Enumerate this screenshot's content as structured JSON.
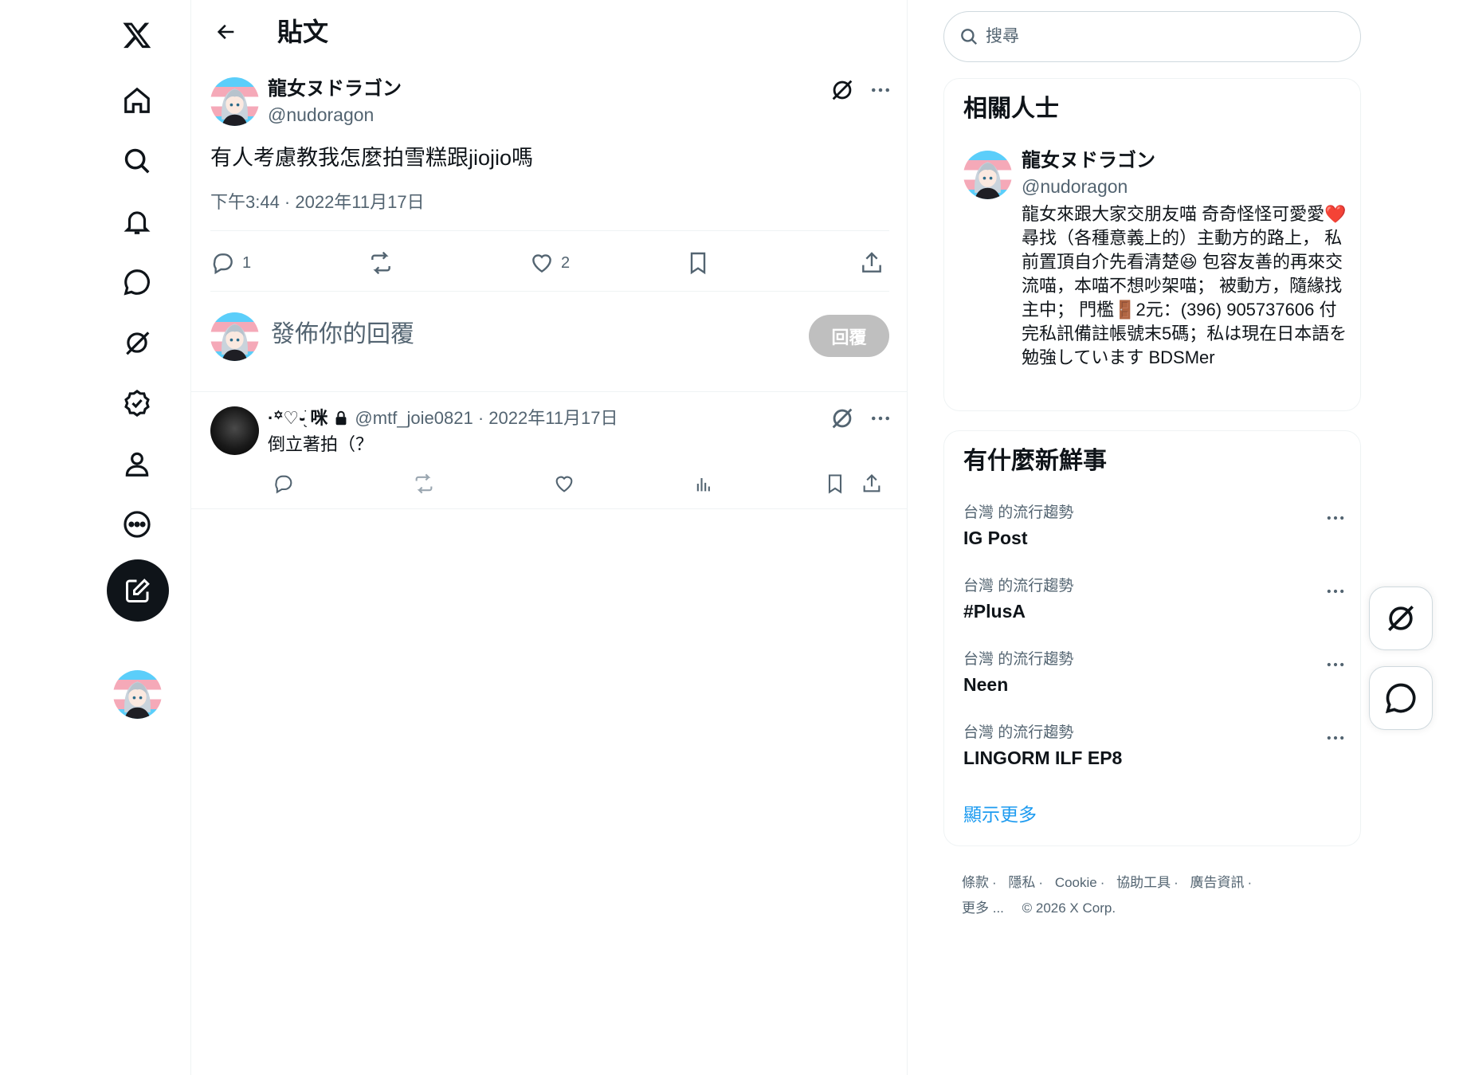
{
  "nav": {
    "items": [
      "x-logo",
      "home",
      "explore",
      "notifications",
      "messages",
      "grok",
      "verified",
      "profile",
      "more"
    ]
  },
  "header": {
    "title": "貼文"
  },
  "post": {
    "author_name": "龍女ヌドラゴン",
    "author_handle": "@nudoragon",
    "text": "有人考慮教我怎麼拍雪糕跟jiojio嗎",
    "timestamp": "下午3:44 · 2022年11月17日",
    "reply_count": "1",
    "like_count": "2"
  },
  "compose_reply": {
    "placeholder": "發佈你的回覆",
    "button_label": "回覆"
  },
  "reply": {
    "name": "·꙳♡֊ֺ֖ 咪",
    "handle_time": "@mtf_joie0821 · 2022年11月17日",
    "text": "倒立著拍（？"
  },
  "search": {
    "placeholder": "搜尋"
  },
  "related_people": {
    "title": "相關人士",
    "name": "龍女ヌドラゴン",
    "handle": "@nudoragon",
    "bio": "龍女來跟大家交朋友喵 奇奇怪怪可愛愛❤️ 尋找（各種意義上的）主動方的路上， 私前置頂自介先看清楚😆 包容友善的再來交流喵，本喵不想吵架喵； 被動方，隨緣找主中； 門檻🚪2元：(396) 905737606 付完私訊備註帳號末5碼；私は現在日本語を勉強しています BDSMer"
  },
  "trends": {
    "title": "有什麼新鮮事",
    "items": [
      {
        "category": "台灣 的流行趨勢",
        "name": "IG Post"
      },
      {
        "category": "台灣 的流行趨勢",
        "name": "#PlusA"
      },
      {
        "category": "台灣 的流行趨勢",
        "name": "Neen"
      },
      {
        "category": "台灣 的流行趨勢",
        "name": "LINGORM ILF EP8"
      }
    ],
    "show_more": "顯示更多"
  },
  "footer": {
    "links": [
      "條款",
      "隱私",
      "Cookie",
      "協助工具",
      "廣告資訊",
      "更多 ..."
    ],
    "copyright": "© 2026 X Corp."
  },
  "colors": {
    "accent": "#1d9bf0",
    "text": "#0f1419",
    "secondary": "#536471",
    "border": "#eff3f4"
  }
}
